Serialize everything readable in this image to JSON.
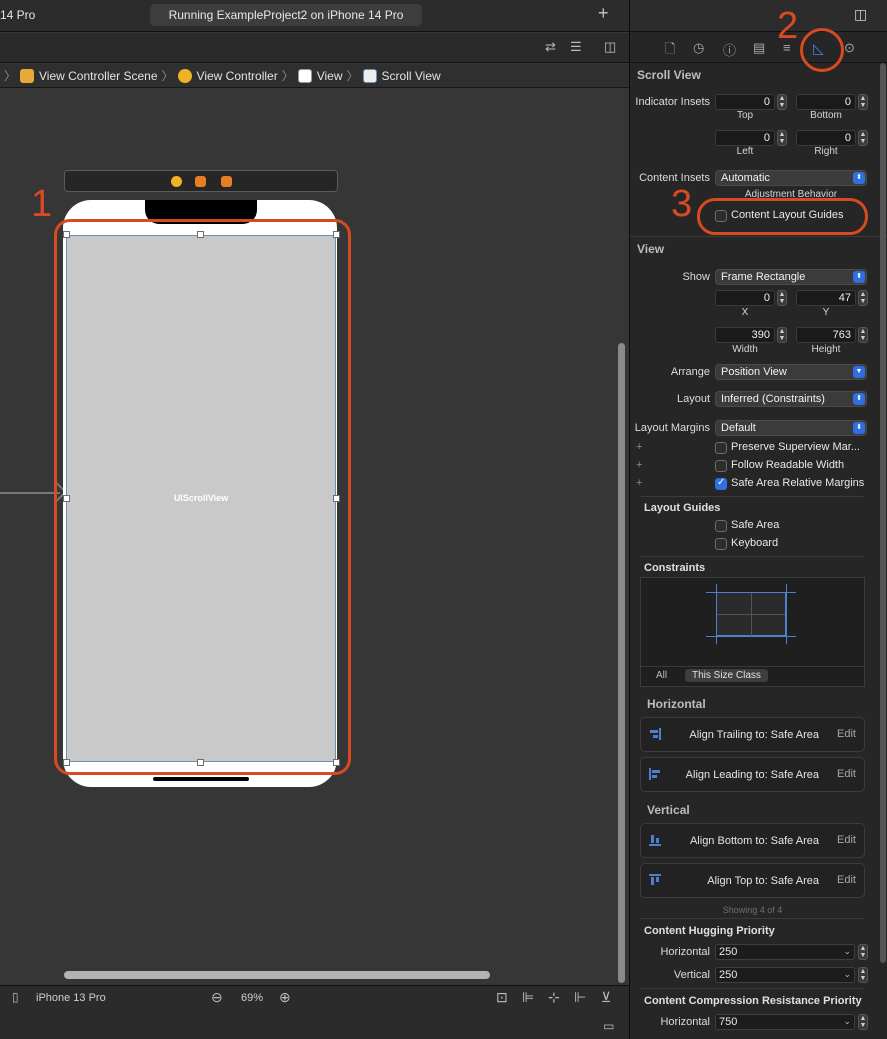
{
  "toolbar": {
    "device_partial": "14 Pro",
    "run_status": "Running ExampleProject2 on iPhone 14 Pro",
    "add_tab": "+"
  },
  "breadcrumbs": [
    {
      "label": "View Controller Scene"
    },
    {
      "label": "View Controller"
    },
    {
      "label": "View"
    },
    {
      "label": "Scroll View"
    }
  ],
  "canvas": {
    "scroll_view_label": "UIScrollView",
    "annotation_1": "1",
    "annotation_2": "2",
    "annotation_3": "3"
  },
  "bottom_bar": {
    "device_config": "iPhone 13 Pro",
    "zoom": "69%"
  },
  "inspector": {
    "scroll_view": {
      "title": "Scroll View",
      "indicator_insets_label": "Indicator Insets",
      "top": {
        "value": "0",
        "label": "Top"
      },
      "bottom": {
        "value": "0",
        "label": "Bottom"
      },
      "left": {
        "value": "0",
        "label": "Left"
      },
      "right": {
        "value": "0",
        "label": "Right"
      },
      "content_insets_label": "Content Insets",
      "content_insets_value": "Automatic",
      "adjustment_behavior": "Adjustment Behavior",
      "content_layout_guides": "Content Layout Guides",
      "content_layout_guides_checked": false
    },
    "view": {
      "title": "View",
      "show_label": "Show",
      "show_value": "Frame Rectangle",
      "x": {
        "value": "0",
        "label": "X"
      },
      "y": {
        "value": "47",
        "label": "Y"
      },
      "width": {
        "value": "390",
        "label": "Width"
      },
      "height": {
        "value": "763",
        "label": "Height"
      },
      "arrange_label": "Arrange",
      "arrange_value": "Position View",
      "layout_label": "Layout",
      "layout_value": "Inferred (Constraints)",
      "layout_margins_label": "Layout Margins",
      "layout_margins_value": "Default",
      "preserve_superview": "Preserve Superview Mar...",
      "follow_readable": "Follow Readable Width",
      "safe_area_relative": "Safe Area Relative Margins",
      "safe_area_relative_checked": true
    },
    "layout_guides": {
      "title": "Layout Guides",
      "safe_area": "Safe Area",
      "keyboard": "Keyboard"
    },
    "constraints": {
      "title": "Constraints",
      "all_tab": "All",
      "size_class_tab": "This Size Class",
      "horizontal_title": "Horizontal",
      "vertical_title": "Vertical",
      "edit_label": "Edit",
      "horizontal": [
        {
          "text": "Align Trailing to:  Safe Area"
        },
        {
          "text": "Align Leading to:  Safe Area"
        }
      ],
      "vertical": [
        {
          "text": "Align Bottom to:  Safe Area"
        },
        {
          "text": "Align Top to:  Safe Area"
        }
      ],
      "showing": "Showing 4 of 4"
    },
    "hugging": {
      "title": "Content Hugging Priority",
      "horizontal_label": "Horizontal",
      "horizontal_value": "250",
      "vertical_label": "Vertical",
      "vertical_value": "250"
    },
    "compression": {
      "title": "Content Compression Resistance Priority",
      "horizontal_label": "Horizontal",
      "horizontal_value": "750"
    }
  },
  "colors": {
    "annotation": "#d74a22",
    "accent": "#2f6fe0"
  }
}
